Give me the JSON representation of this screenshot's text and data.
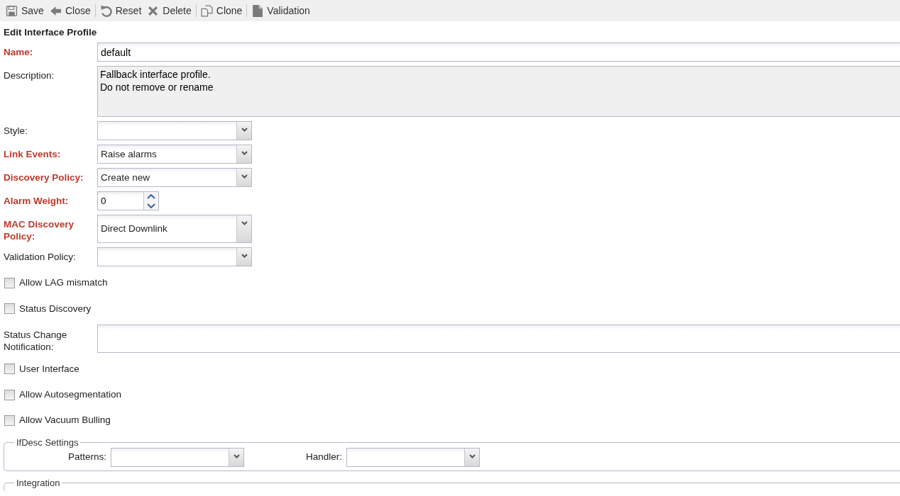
{
  "toolbar": [
    [
      {
        "kind": "save",
        "label": "Save"
      },
      {
        "kind": "close",
        "label": "Close"
      }
    ],
    [
      {
        "kind": "reset",
        "label": "Reset"
      },
      {
        "kind": "delete",
        "label": "Delete"
      }
    ],
    [
      {
        "kind": "clone",
        "label": "Clone"
      }
    ],
    [
      {
        "kind": "validation",
        "label": "Validation"
      }
    ]
  ],
  "form_title": "Edit Interface Profile",
  "fields": [
    {
      "kind": "text",
      "label": "Name:",
      "required": true,
      "value": "default"
    },
    {
      "kind": "textarea",
      "label": "Description:",
      "required": false,
      "value": "Fallback interface profile.\nDo not remove or rename"
    },
    {
      "kind": "combo",
      "label": "Style:",
      "required": false
    },
    {
      "kind": "combo",
      "label": "Link Events:",
      "required": true,
      "value": "Raise alarms"
    },
    {
      "kind": "combo",
      "label": "Discovery Policy:",
      "required": true,
      "value": "Create new"
    },
    {
      "kind": "spinner",
      "label": "Alarm Weight:",
      "required": true,
      "value": "0"
    },
    {
      "kind": "combo",
      "label": "MAC Discovery Policy:",
      "required": true,
      "value": "Direct Downlink"
    },
    {
      "kind": "combo",
      "label": "Validation Policy:",
      "required": false
    },
    {
      "kind": "checkbox",
      "label": "Allow LAG mismatch",
      "checked": false
    },
    {
      "kind": "checkbox",
      "label": "Status Discovery",
      "checked": false
    },
    {
      "kind": "text",
      "label": "Status Change Notification:",
      "required": false
    },
    {
      "kind": "checkbox",
      "label": "User Interface",
      "checked": false
    },
    {
      "kind": "checkbox",
      "label": "Allow Autosegmentation",
      "checked": false
    },
    {
      "kind": "checkbox",
      "label": "Allow Vacuum Bulling",
      "checked": false
    }
  ],
  "ifdesc_settings": {
    "legend": "IfDesc Settings",
    "fields": [
      {
        "label": "Patterns:"
      },
      {
        "label": "Handler:"
      }
    ]
  },
  "integration": {
    "legend": "Integration"
  }
}
